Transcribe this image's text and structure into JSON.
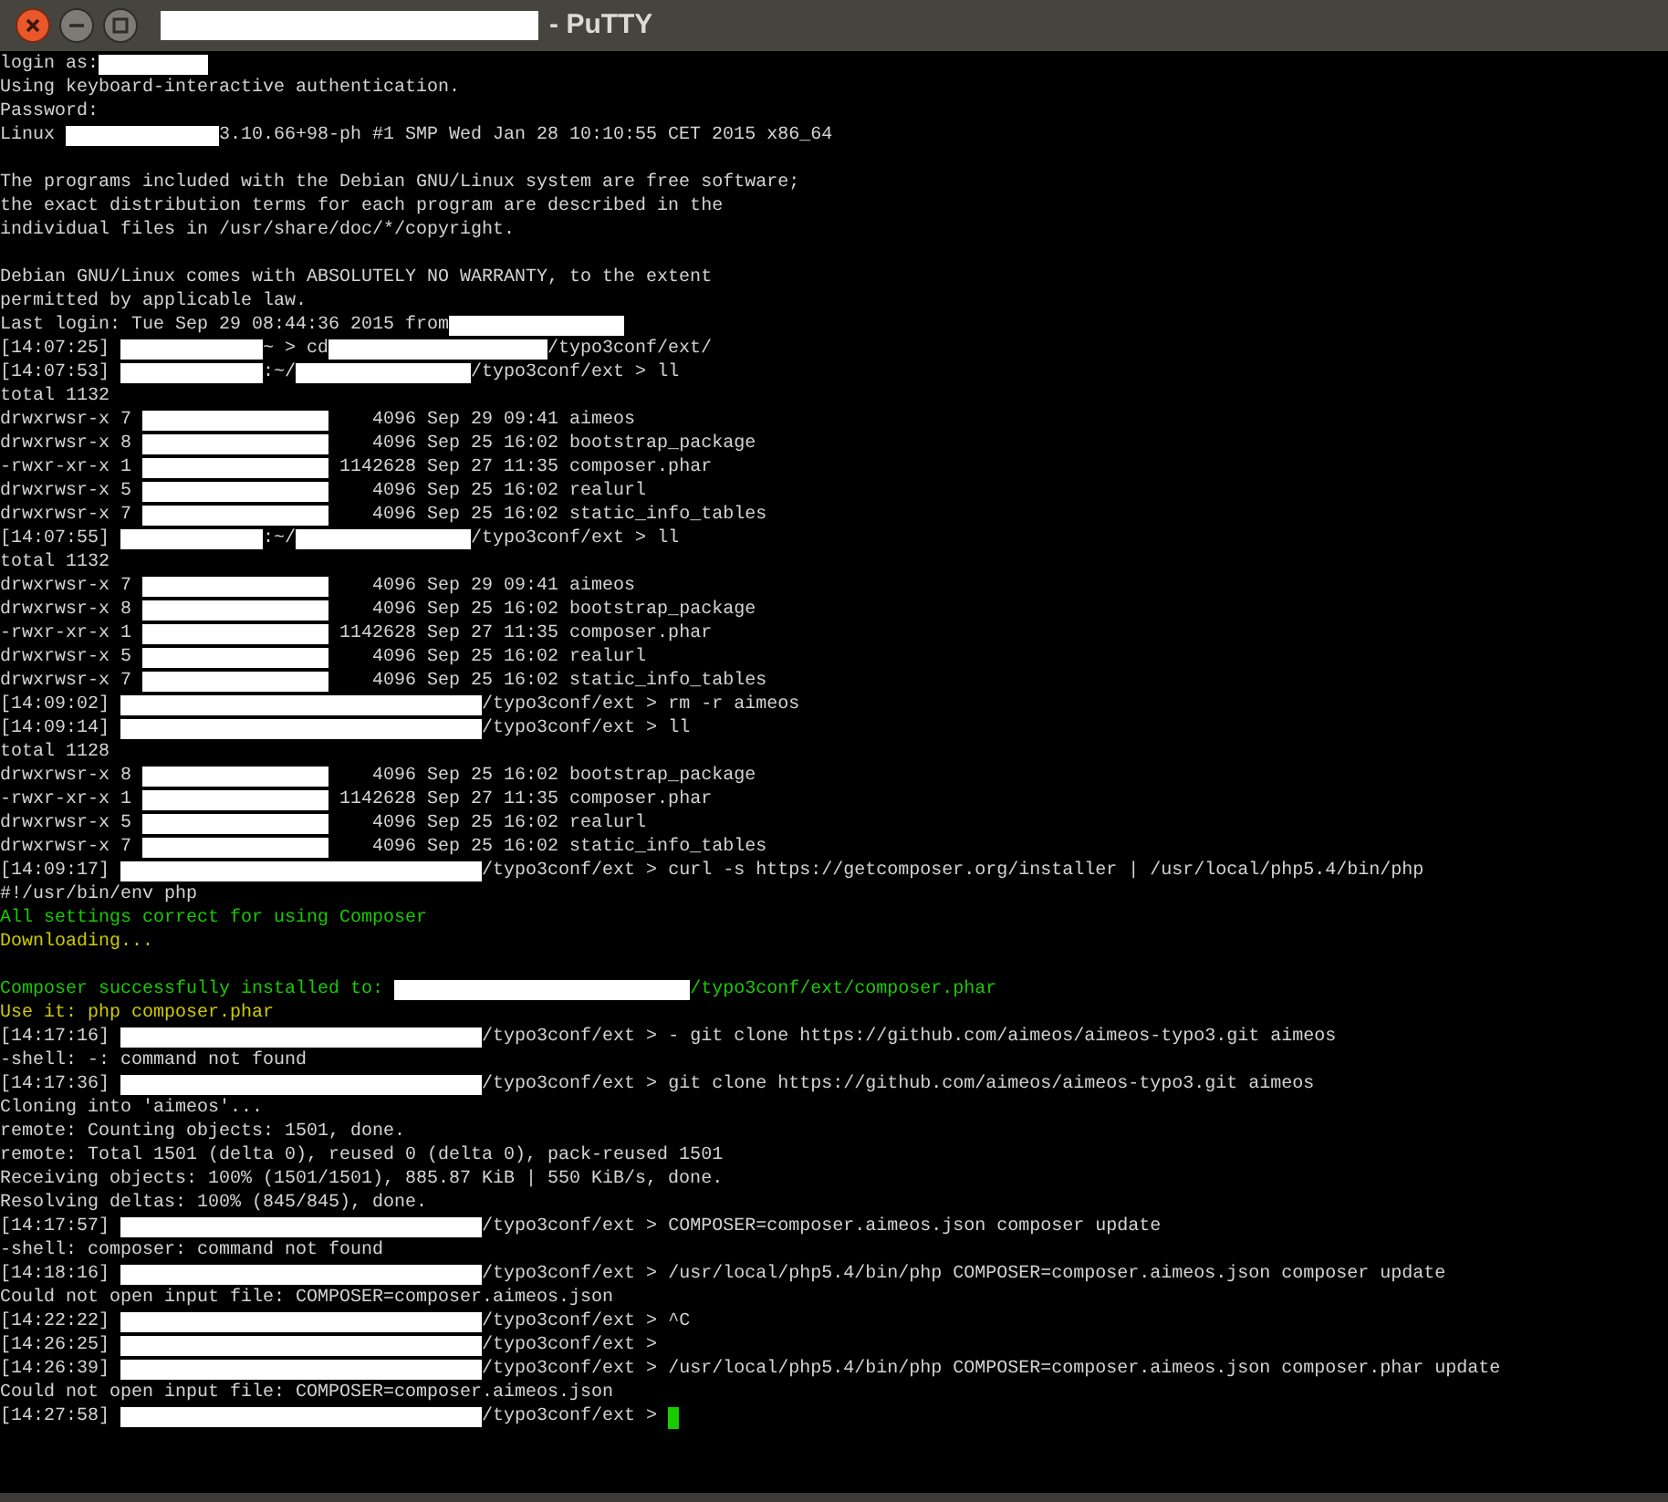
{
  "window": {
    "title": [
      {
        "kind": "redacted"
      },
      {
        "kind": "text",
        "text": "- PuTTY"
      }
    ]
  },
  "terminal": {
    "lines": [
      {
        "kind": "output",
        "segments": [
          {
            "kind": "text",
            "text": "login as:"
          },
          {
            "kind": "redacted"
          }
        ]
      },
      {
        "kind": "output",
        "segments": [
          {
            "kind": "text",
            "text": "Using keyboard-interactive authentication."
          }
        ]
      },
      {
        "kind": "output",
        "segments": [
          {
            "kind": "text",
            "text": "Password:"
          }
        ]
      },
      {
        "kind": "output",
        "segments": [
          {
            "kind": "text",
            "text": "Linux "
          },
          {
            "kind": "redacted"
          },
          {
            "kind": "text",
            "text": "3.10.66+98-ph #1 SMP Wed Jan 28 10:10:55 CET 2015 x86_64"
          }
        ]
      },
      {
        "kind": "blank"
      },
      {
        "kind": "output",
        "segments": [
          {
            "kind": "text",
            "text": "The programs included with the Debian GNU/Linux system are free software;"
          }
        ]
      },
      {
        "kind": "output",
        "segments": [
          {
            "kind": "text",
            "text": "the exact distribution terms for each program are described in the"
          }
        ]
      },
      {
        "kind": "output",
        "segments": [
          {
            "kind": "text",
            "text": "individual files in /usr/share/doc/*/copyright."
          }
        ]
      },
      {
        "kind": "blank"
      },
      {
        "kind": "output",
        "segments": [
          {
            "kind": "text",
            "text": "Debian GNU/Linux comes with ABSOLUTELY NO WARRANTY, to the extent"
          }
        ]
      },
      {
        "kind": "output",
        "segments": [
          {
            "kind": "text",
            "text": "permitted by applicable law."
          }
        ]
      },
      {
        "kind": "output",
        "segments": [
          {
            "kind": "text",
            "text": "Last login: Tue Sep 29 08:44:36 2015 from"
          },
          {
            "kind": "redacted"
          }
        ]
      },
      {
        "kind": "output",
        "segments": [
          {
            "kind": "text",
            "text": "[14:07:25] "
          },
          {
            "kind": "redacted"
          },
          {
            "kind": "text",
            "text": "~ > cd"
          },
          {
            "kind": "redacted"
          },
          {
            "kind": "text",
            "text": "/typo3conf/ext/"
          }
        ]
      },
      {
        "kind": "output",
        "segments": [
          {
            "kind": "text",
            "text": "[14:07:53] "
          },
          {
            "kind": "redacted"
          },
          {
            "kind": "text",
            "text": ":~/"
          },
          {
            "kind": "redacted"
          },
          {
            "kind": "text",
            "text": "/typo3conf/ext > ll"
          }
        ]
      },
      {
        "kind": "output",
        "segments": [
          {
            "kind": "text",
            "text": "total 1132"
          }
        ]
      },
      {
        "kind": "output",
        "segments": [
          {
            "kind": "text",
            "text": "drwxrwsr-x 7 "
          },
          {
            "kind": "redacted"
          },
          {
            "kind": "text",
            "text": "    4096 Sep 29 09:41 aimeos"
          }
        ]
      },
      {
        "kind": "output",
        "segments": [
          {
            "kind": "text",
            "text": "drwxrwsr-x 8 "
          },
          {
            "kind": "redacted"
          },
          {
            "kind": "text",
            "text": "    4096 Sep 25 16:02 bootstrap_package"
          }
        ]
      },
      {
        "kind": "output",
        "segments": [
          {
            "kind": "text",
            "text": "-rwxr-xr-x 1 "
          },
          {
            "kind": "redacted"
          },
          {
            "kind": "text",
            "text": " 1142628 Sep 27 11:35 composer.phar"
          }
        ]
      },
      {
        "kind": "output",
        "segments": [
          {
            "kind": "text",
            "text": "drwxrwsr-x 5 "
          },
          {
            "kind": "redacted"
          },
          {
            "kind": "text",
            "text": "    4096 Sep 25 16:02 realurl"
          }
        ]
      },
      {
        "kind": "output",
        "segments": [
          {
            "kind": "text",
            "text": "drwxrwsr-x 7 "
          },
          {
            "kind": "redacted"
          },
          {
            "kind": "text",
            "text": "    4096 Sep 25 16:02 static_info_tables"
          }
        ]
      },
      {
        "kind": "output",
        "segments": [
          {
            "kind": "text",
            "text": "[14:07:55] "
          },
          {
            "kind": "redacted"
          },
          {
            "kind": "text",
            "text": ":~/"
          },
          {
            "kind": "redacted"
          },
          {
            "kind": "text",
            "text": "/typo3conf/ext > ll"
          }
        ]
      },
      {
        "kind": "output",
        "segments": [
          {
            "kind": "text",
            "text": "total 1132"
          }
        ]
      },
      {
        "kind": "output",
        "segments": [
          {
            "kind": "text",
            "text": "drwxrwsr-x 7 "
          },
          {
            "kind": "redacted"
          },
          {
            "kind": "text",
            "text": "    4096 Sep 29 09:41 aimeos"
          }
        ]
      },
      {
        "kind": "output",
        "segments": [
          {
            "kind": "text",
            "text": "drwxrwsr-x 8 "
          },
          {
            "kind": "redacted"
          },
          {
            "kind": "text",
            "text": "    4096 Sep 25 16:02 bootstrap_package"
          }
        ]
      },
      {
        "kind": "output",
        "segments": [
          {
            "kind": "text",
            "text": "-rwxr-xr-x 1 "
          },
          {
            "kind": "redacted"
          },
          {
            "kind": "text",
            "text": " 1142628 Sep 27 11:35 composer.phar"
          }
        ]
      },
      {
        "kind": "output",
        "segments": [
          {
            "kind": "text",
            "text": "drwxrwsr-x 5 "
          },
          {
            "kind": "redacted"
          },
          {
            "kind": "text",
            "text": "    4096 Sep 25 16:02 realurl"
          }
        ]
      },
      {
        "kind": "output",
        "segments": [
          {
            "kind": "text",
            "text": "drwxrwsr-x 7 "
          },
          {
            "kind": "redacted"
          },
          {
            "kind": "text",
            "text": "    4096 Sep 25 16:02 static_info_tables"
          }
        ]
      },
      {
        "kind": "output",
        "segments": [
          {
            "kind": "text",
            "text": "[14:09:02] "
          },
          {
            "kind": "redacted"
          },
          {
            "kind": "text",
            "text": "/typo3conf/ext > rm -r aimeos"
          }
        ]
      },
      {
        "kind": "output",
        "segments": [
          {
            "kind": "text",
            "text": "[14:09:14] "
          },
          {
            "kind": "redacted"
          },
          {
            "kind": "text",
            "text": "/typo3conf/ext > ll"
          }
        ]
      },
      {
        "kind": "output",
        "segments": [
          {
            "kind": "text",
            "text": "total 1128"
          }
        ]
      },
      {
        "kind": "output",
        "segments": [
          {
            "kind": "text",
            "text": "drwxrwsr-x 8 "
          },
          {
            "kind": "redacted"
          },
          {
            "kind": "text",
            "text": "    4096 Sep 25 16:02 bootstrap_package"
          }
        ]
      },
      {
        "kind": "output",
        "segments": [
          {
            "kind": "text",
            "text": "-rwxr-xr-x 1 "
          },
          {
            "kind": "redacted"
          },
          {
            "kind": "text",
            "text": " 1142628 Sep 27 11:35 composer.phar"
          }
        ]
      },
      {
        "kind": "output",
        "segments": [
          {
            "kind": "text",
            "text": "drwxrwsr-x 5 "
          },
          {
            "kind": "redacted"
          },
          {
            "kind": "text",
            "text": "    4096 Sep 25 16:02 realurl"
          }
        ]
      },
      {
        "kind": "output",
        "segments": [
          {
            "kind": "text",
            "text": "drwxrwsr-x 7 "
          },
          {
            "kind": "redacted"
          },
          {
            "kind": "text",
            "text": "    4096 Sep 25 16:02 static_info_tables"
          }
        ]
      },
      {
        "kind": "output",
        "segments": [
          {
            "kind": "text",
            "text": "[14:09:17] "
          },
          {
            "kind": "redacted"
          },
          {
            "kind": "text",
            "text": "/typo3conf/ext > curl -s https://getcomposer.org/installer | /usr/local/php5.4/bin/php"
          }
        ]
      },
      {
        "kind": "output",
        "segments": [
          {
            "kind": "text",
            "text": "#!/usr/bin/env php"
          }
        ]
      },
      {
        "kind": "output",
        "color": "#19cb00",
        "segments": [
          {
            "kind": "text",
            "text": "All settings correct for using Composer"
          }
        ]
      },
      {
        "kind": "output",
        "color": "#cecb00",
        "segments": [
          {
            "kind": "text",
            "text": "Downloading..."
          }
        ]
      },
      {
        "kind": "blank"
      },
      {
        "kind": "output",
        "color": "#19cb00",
        "segments": [
          {
            "kind": "text",
            "text": "Composer successfully installed to: "
          },
          {
            "kind": "redacted"
          },
          {
            "kind": "text",
            "text": "/typo3conf/ext/composer.phar"
          }
        ]
      },
      {
        "kind": "output",
        "color": "#cecb00",
        "segments": [
          {
            "kind": "text",
            "text": "Use it: php composer.phar"
          }
        ]
      },
      {
        "kind": "output",
        "segments": [
          {
            "kind": "text",
            "text": "[14:17:16] "
          },
          {
            "kind": "redacted"
          },
          {
            "kind": "text",
            "text": "/typo3conf/ext > - git clone https://github.com/aimeos/aimeos-typo3.git aimeos"
          }
        ]
      },
      {
        "kind": "output",
        "segments": [
          {
            "kind": "text",
            "text": "-shell: -: command not found"
          }
        ]
      },
      {
        "kind": "output",
        "segments": [
          {
            "kind": "text",
            "text": "[14:17:36] "
          },
          {
            "kind": "redacted"
          },
          {
            "kind": "text",
            "text": "/typo3conf/ext > git clone https://github.com/aimeos/aimeos-typo3.git aimeos"
          }
        ]
      },
      {
        "kind": "output",
        "segments": [
          {
            "kind": "text",
            "text": "Cloning into 'aimeos'..."
          }
        ]
      },
      {
        "kind": "output",
        "segments": [
          {
            "kind": "text",
            "text": "remote: Counting objects: 1501, done."
          }
        ]
      },
      {
        "kind": "output",
        "segments": [
          {
            "kind": "text",
            "text": "remote: Total 1501 (delta 0), reused 0 (delta 0), pack-reused 1501"
          }
        ]
      },
      {
        "kind": "output",
        "segments": [
          {
            "kind": "text",
            "text": "Receiving objects: 100% (1501/1501), 885.87 KiB | 550 KiB/s, done."
          }
        ]
      },
      {
        "kind": "output",
        "segments": [
          {
            "kind": "text",
            "text": "Resolving deltas: 100% (845/845), done."
          }
        ]
      },
      {
        "kind": "output",
        "segments": [
          {
            "kind": "text",
            "text": "[14:17:57] "
          },
          {
            "kind": "redacted"
          },
          {
            "kind": "text",
            "text": "/typo3conf/ext > COMPOSER=composer.aimeos.json composer update"
          }
        ]
      },
      {
        "kind": "output",
        "segments": [
          {
            "kind": "text",
            "text": "-shell: composer: command not found"
          }
        ]
      },
      {
        "kind": "output",
        "segments": [
          {
            "kind": "text",
            "text": "[14:18:16] "
          },
          {
            "kind": "redacted"
          },
          {
            "kind": "text",
            "text": "/typo3conf/ext > /usr/local/php5.4/bin/php COMPOSER=composer.aimeos.json composer update"
          }
        ]
      },
      {
        "kind": "output",
        "segments": [
          {
            "kind": "text",
            "text": "Could not open input file: COMPOSER=composer.aimeos.json"
          }
        ]
      },
      {
        "kind": "output",
        "segments": [
          {
            "kind": "text",
            "text": "[14:22:22] "
          },
          {
            "kind": "redacted"
          },
          {
            "kind": "text",
            "text": "/typo3conf/ext > ^C"
          }
        ]
      },
      {
        "kind": "output",
        "segments": [
          {
            "kind": "text",
            "text": "[14:26:25] "
          },
          {
            "kind": "redacted"
          },
          {
            "kind": "text",
            "text": "/typo3conf/ext >"
          }
        ]
      },
      {
        "kind": "output",
        "segments": [
          {
            "kind": "text",
            "text": "[14:26:39] "
          },
          {
            "kind": "redacted"
          },
          {
            "kind": "text",
            "text": "/typo3conf/ext > /usr/local/php5.4/bin/php COMPOSER=composer.aimeos.json composer.phar update"
          }
        ]
      },
      {
        "kind": "output",
        "segments": [
          {
            "kind": "text",
            "text": "Could not open input file: COMPOSER=composer.aimeos.json"
          }
        ]
      },
      {
        "kind": "output",
        "cursor": true,
        "segments": [
          {
            "kind": "text",
            "text": "[14:27:58] "
          },
          {
            "kind": "redacted"
          },
          {
            "kind": "text",
            "text": "/typo3conf/ext > "
          }
        ]
      }
    ]
  }
}
